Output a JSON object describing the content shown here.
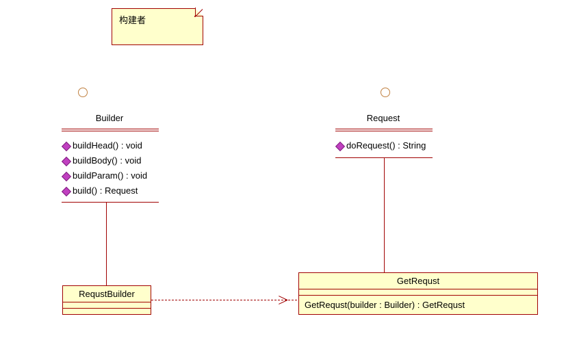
{
  "note": {
    "text": "构建者"
  },
  "builder": {
    "name": "Builder",
    "methods": [
      "buildHead() : void",
      "buildBody() : void",
      "buildParam() : void",
      "build() : Request"
    ]
  },
  "request": {
    "name": "Request",
    "methods": [
      "doRequest() : String"
    ]
  },
  "requstBuilder": {
    "name": "RequstBuilder"
  },
  "getRequst": {
    "name": "GetRequst",
    "methods": [
      "GetRequst(builder : Builder) : GetRequst"
    ]
  }
}
